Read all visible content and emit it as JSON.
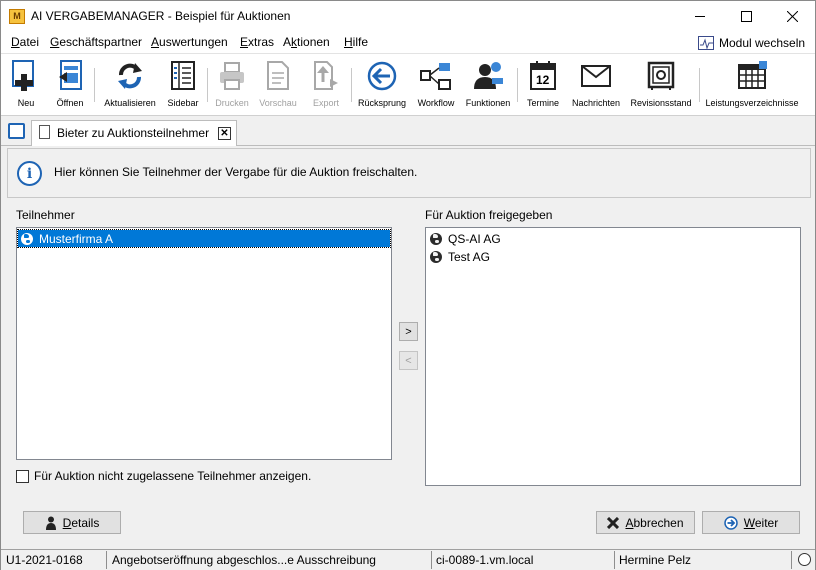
{
  "window": {
    "title": "AI VERGABEMANAGER - Beispiel für Auktionen",
    "icon_text": "M"
  },
  "menu": {
    "items": [
      "Datei",
      "Geschäftspartner",
      "Auswertungen",
      "Extras",
      "Aktionen",
      "Hilfe"
    ],
    "modul_label": "Modul wechseln"
  },
  "toolbar": {
    "buttons": [
      {
        "label": "Neu",
        "icon": "new-plus-icon",
        "enabled": true
      },
      {
        "label": "Öffnen",
        "icon": "open-document-icon",
        "enabled": true
      },
      {
        "label": "Aktualisieren",
        "icon": "refresh-icon",
        "enabled": true
      },
      {
        "label": "Sidebar",
        "icon": "sidebar-icon",
        "enabled": true
      },
      {
        "label": "Drucken",
        "icon": "printer-icon",
        "enabled": false
      },
      {
        "label": "Vorschau",
        "icon": "preview-icon",
        "enabled": false
      },
      {
        "label": "Export",
        "icon": "export-icon",
        "enabled": false
      },
      {
        "label": "Rücksprung",
        "icon": "back-arrow-icon",
        "enabled": true
      },
      {
        "label": "Workflow",
        "icon": "workflow-icon",
        "enabled": true
      },
      {
        "label": "Funktionen",
        "icon": "functions-user-icon",
        "enabled": true
      },
      {
        "label": "Termine",
        "icon": "calendar-icon",
        "enabled": true
      },
      {
        "label": "Nachrichten",
        "icon": "envelope-icon",
        "enabled": true
      },
      {
        "label": "Revisionsstand",
        "icon": "safe-icon",
        "enabled": true
      },
      {
        "label": "Leistungsverzeichnisse",
        "icon": "table-icon",
        "enabled": true
      }
    ],
    "calendar_day": "12"
  },
  "tabs": {
    "active_label": "Bieter zu Auktionsteilnehmer"
  },
  "info": {
    "text": "Hier können Sie Teilnehmer der Vergabe für die Auktion freischalten."
  },
  "left_list": {
    "label": "Teilnehmer",
    "items": [
      "Musterfirma A"
    ],
    "selected_index": 0
  },
  "right_list": {
    "label": "Für Auktion freigegeben",
    "items": [
      "QS-AI AG",
      "Test AG"
    ]
  },
  "move_buttons": {
    "add": ">",
    "remove": "<"
  },
  "checkbox": {
    "label": "Für Auktion nicht zugelassene Teilnehmer anzeigen.",
    "checked": false
  },
  "buttons": {
    "details_first": "D",
    "details_rest": "etails",
    "cancel_first": "A",
    "cancel_rest": "bbrechen",
    "next_first": "W",
    "next_rest": "eiter"
  },
  "status": {
    "id": "U1-2021-0168",
    "state": "Angebotseröffnung abgeschlos...e Ausschreibung",
    "host": "ci-0089-1.vm.local",
    "user": "Hermine Pelz"
  },
  "colors": {
    "accent": "#0078d7",
    "icon_blue": "#1e64b4"
  }
}
